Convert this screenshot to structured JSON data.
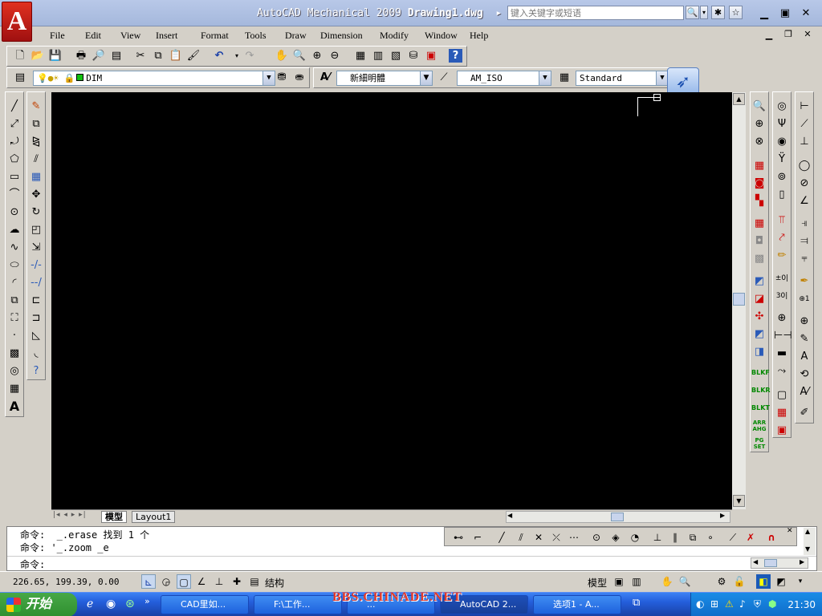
{
  "window": {
    "title_app": "AutoCAD Mechanical 2009",
    "title_doc": "Drawing1.dwg",
    "search_placeholder": "键入关键字或短语",
    "logo_letter": "A"
  },
  "menu": [
    "File",
    "Edit",
    "View",
    "Insert",
    "Format",
    "Tools",
    "Draw",
    "Dimension",
    "Modify",
    "Window",
    "Help"
  ],
  "layer_toolbar": {
    "layer": "DIM"
  },
  "style_toolbar": {
    "text_style": "新細明體",
    "dim_style": "AM_ISO",
    "table_style": "Standard"
  },
  "layout_tabs": {
    "model": "模型",
    "layout1": "Layout1"
  },
  "command": {
    "line1": "命令:  _.erase 找到 1 个",
    "line2": "命令: '_.zoom _e",
    "prompt": "命令:"
  },
  "status": {
    "coords": "226.65, 199.39, 0.00",
    "struct_label": "结构",
    "model_label": "模型"
  },
  "side_labels": [
    "BLKF",
    "BLKR",
    "BLKT",
    "ARR AHG",
    "PG SET"
  ],
  "taskbar": {
    "start": "开始",
    "tasks": [
      "CAD里如...",
      "F:\\工作...",
      "...",
      "AutoCAD 2...",
      "选项1 - A..."
    ],
    "clock": "21:30"
  },
  "watermark": "BBS.CHINADE.NET",
  "colors": {
    "canvas": "#000000",
    "title_bar": "#a5b8dc",
    "taskbar": "#245edb",
    "logo": "#c01818"
  }
}
